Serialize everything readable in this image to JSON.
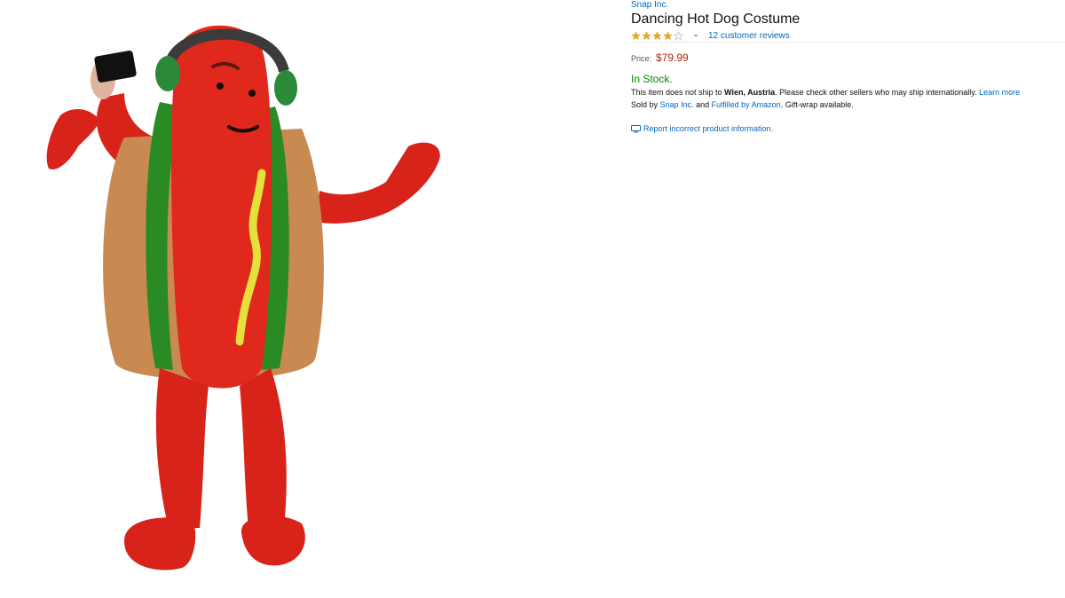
{
  "product": {
    "brand": "Snap Inc.",
    "title": "Dancing Hot Dog Costume",
    "rating": 4,
    "rating_max": 5,
    "reviews_link": "12 customer reviews",
    "price_label": "Price:",
    "price": "$79.99",
    "stock_status": "In Stock.",
    "shipping": {
      "prefix": "This item does not ship to",
      "location": "Wien, Austria",
      "suffix": ". Please check other sellers who may ship internationally.",
      "learn_more": "Learn more"
    },
    "seller": {
      "sold_by_prefix": "Sold by",
      "seller_name": "Snap Inc.",
      "and": "and",
      "fulfilled": "Fulfilled by Amazon",
      "gift": ". Gift-wrap available."
    },
    "report_link": "Report incorrect product information."
  },
  "icons": {
    "star": "star-icon",
    "chevron": "chevron-down-icon",
    "report": "monitor-icon"
  },
  "colors": {
    "link": "#0066c0",
    "price": "#b12704",
    "in_stock": "#008a00",
    "star": "#f0a91e"
  }
}
